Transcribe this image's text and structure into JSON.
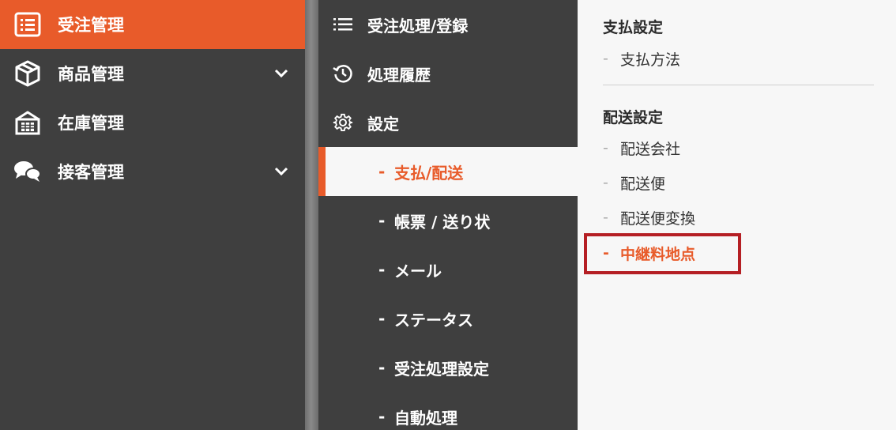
{
  "colors": {
    "accent": "#e85b2a",
    "dark_bg": "#3f3f3f",
    "panel_bg": "#f7f7f7",
    "highlight_box": "#b51f24"
  },
  "main_nav": {
    "items": [
      {
        "label": "受注管理",
        "icon": "order-list-icon",
        "active": true
      },
      {
        "label": "商品管理",
        "icon": "box-icon",
        "expandable": true
      },
      {
        "label": "在庫管理",
        "icon": "warehouse-icon"
      },
      {
        "label": "接客管理",
        "icon": "chat-bubbles-icon",
        "expandable": true
      }
    ]
  },
  "sub_nav": {
    "items": [
      {
        "label": "受注処理/登録",
        "icon": "list-icon"
      },
      {
        "label": "処理履歴",
        "icon": "history-icon"
      },
      {
        "label": "設定",
        "icon": "gear-icon"
      }
    ],
    "children": [
      {
        "label": "支払/配送",
        "active": true
      },
      {
        "label": "帳票 / 送り状"
      },
      {
        "label": "メール"
      },
      {
        "label": "ステータス"
      },
      {
        "label": "受注処理設定"
      },
      {
        "label": "自動処理"
      }
    ],
    "dash": "-"
  },
  "panel": {
    "sections": [
      {
        "title": "支払設定",
        "items": [
          "支払方法"
        ]
      },
      {
        "title": "配送設定",
        "items": [
          "配送会社",
          "配送便",
          "配送便変換",
          "中継料地点"
        ]
      }
    ],
    "highlighted_item": "中継料地点",
    "dash": "-"
  }
}
